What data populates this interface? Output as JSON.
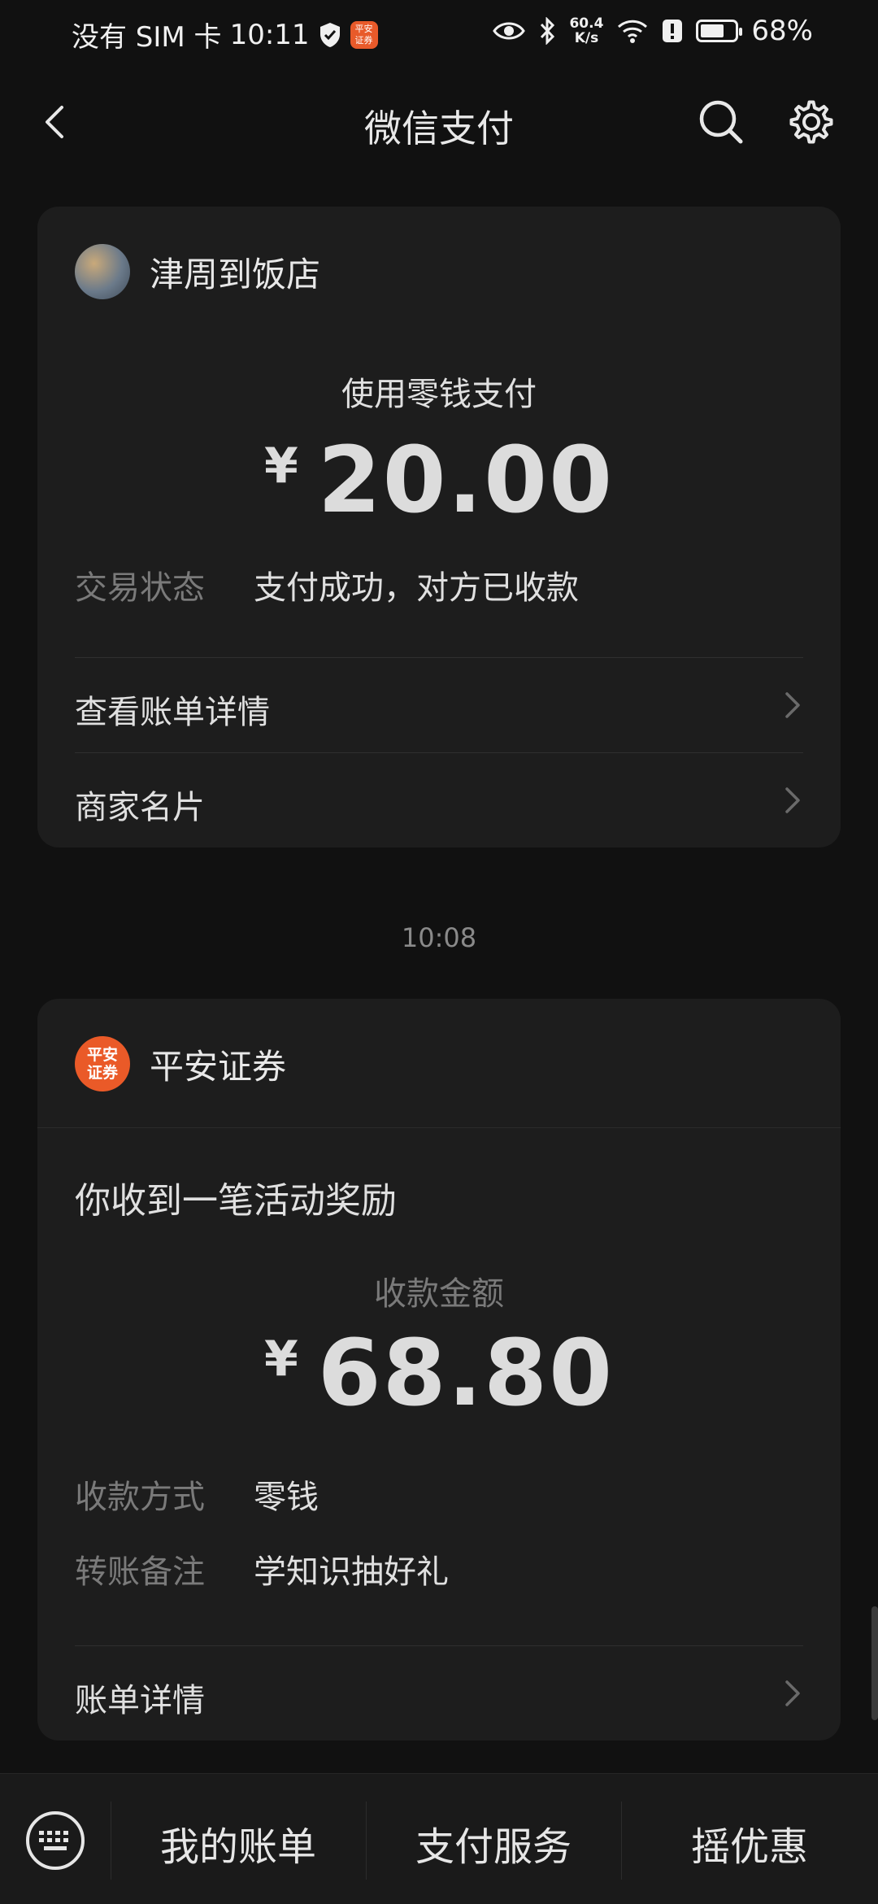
{
  "status_bar": {
    "carrier": "没有 SIM 卡",
    "time": "10:11",
    "app_badge": "平安证券",
    "speed_value": "60.4",
    "speed_unit": "K/s",
    "battery": "68%",
    "battery_level": 0.68
  },
  "nav": {
    "title": "微信支付",
    "icons": [
      "back-icon",
      "search-icon",
      "gear-icon"
    ]
  },
  "card1": {
    "merchant": "津周到饭店",
    "method": "使用零钱支付",
    "currency": "¥",
    "amount": "20.00",
    "status_key": "交易状态",
    "status_value": "支付成功，对方已收款",
    "link1": "查看账单详情",
    "link2": "商家名片"
  },
  "timestamp": "10:08",
  "card2": {
    "merchant": "平安证券",
    "avatar_text": "平安证券",
    "headline": "你收到一笔活动奖励",
    "amount_label": "收款金额",
    "currency": "¥",
    "amount": "68.80",
    "rows": [
      {
        "key": "收款方式",
        "value": "零钱"
      },
      {
        "key": "转账备注",
        "value": "学知识抽好礼"
      }
    ],
    "link": "账单详情"
  },
  "bottom_bar": {
    "items": [
      "我的账单",
      "支付服务",
      "摇优惠"
    ]
  },
  "colors": {
    "background": "#111111",
    "card": "#1d1d1d",
    "accent_orange": "#ea5a28"
  }
}
